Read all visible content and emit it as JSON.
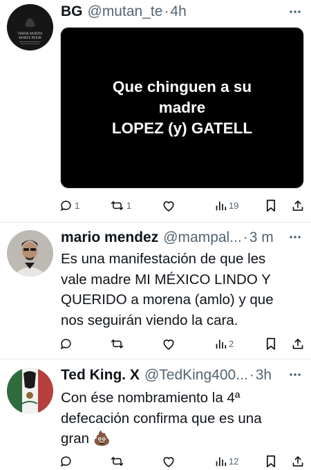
{
  "tweets": [
    {
      "name": "BG",
      "handle": "@mutan_te",
      "separator": "·",
      "time": "4h",
      "avatar_text_1": "TIMOR MORTIS",
      "avatar_text_2": "MORTE PEIOR",
      "media_text_1": "Que chinguen a su",
      "media_text_2": "madre",
      "media_text_3": "LOPEZ (y) GATELL",
      "replies": "1",
      "reposts": "1",
      "likes": "",
      "views": "19"
    },
    {
      "name": "mario mendez",
      "handle": "@mampal...",
      "separator": "·",
      "time": "3 m",
      "text_lines": [
        "Es una manifestación de que les",
        "vale madre  MI MÉXICO LINDO Y",
        "QUERIDO a morena (amlo) y que",
        "nos seguirán viendo la cara."
      ],
      "replies": "",
      "reposts": "",
      "likes": "",
      "views": "2"
    },
    {
      "name": "Ted King. X",
      "handle": "@TedKing400...",
      "separator": "·",
      "time": "3h",
      "text_lines": [
        "Con ése nombramiento la 4ª",
        "defecación confirma que es una",
        "gran 💩"
      ],
      "replies": "",
      "reposts": "",
      "likes": "",
      "views": "12"
    }
  ],
  "icons": {
    "more": "more-dots-icon",
    "reply": "reply-icon",
    "repost": "repost-icon",
    "like": "heart-icon",
    "views": "views-bars-icon",
    "bookmark": "bookmark-icon",
    "share": "share-icon"
  },
  "colors": {
    "text": "#0f1419",
    "secondary": "#536471",
    "divider": "#e6e9ec",
    "media_bg": "#000000"
  }
}
